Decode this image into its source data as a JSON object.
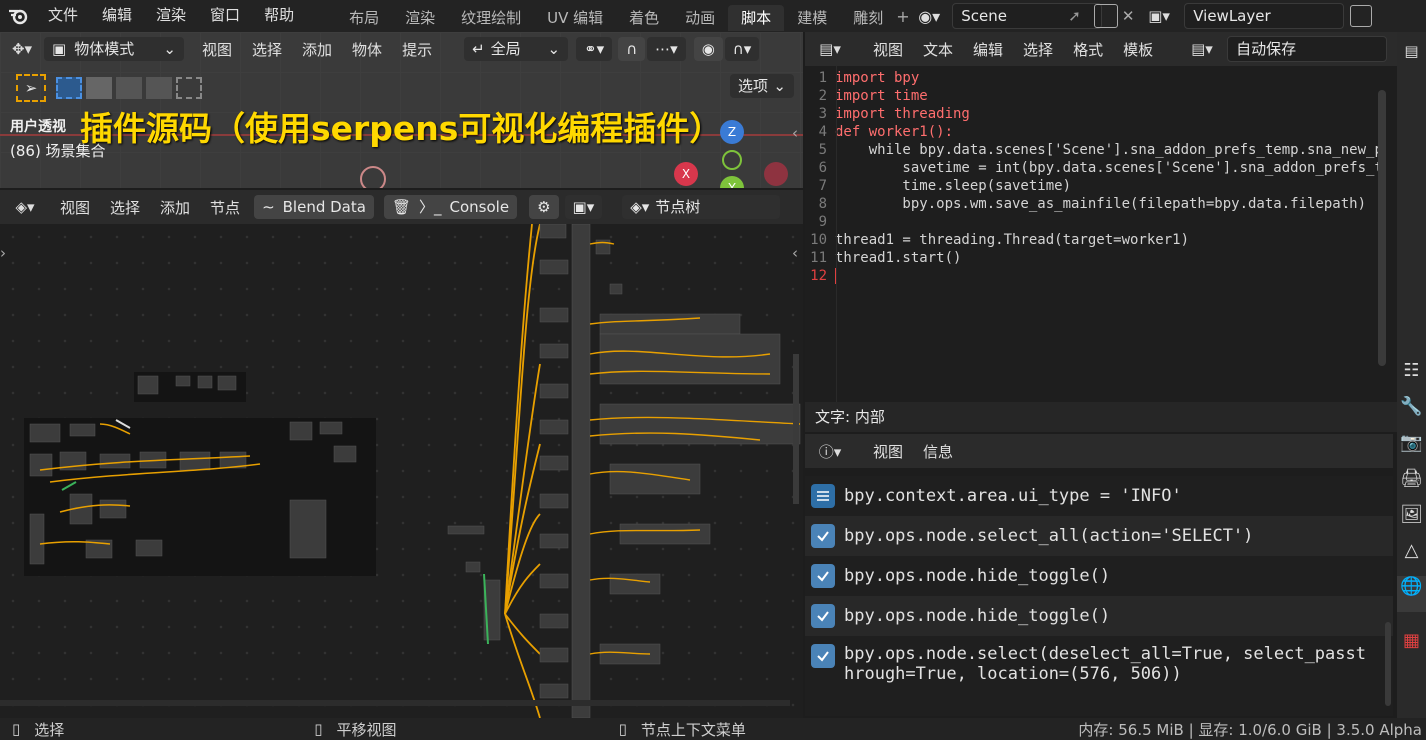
{
  "topbar": {
    "menus": [
      "文件",
      "编辑",
      "渲染",
      "窗口",
      "帮助"
    ],
    "workspaces": [
      "布局",
      "渲染",
      "纹理绘制",
      "UV 编辑",
      "着色",
      "动画",
      "脚本",
      "建模",
      "雕刻"
    ],
    "active_workspace": "脚本",
    "scene_name": "Scene",
    "view_layer": "ViewLayer"
  },
  "viewport": {
    "mode": "物体模式",
    "menus": [
      "视图",
      "选择",
      "添加",
      "物体",
      "提示"
    ],
    "transform_orientation": "全局",
    "options_label": "选项",
    "view_name": "用户透视",
    "collection": "(86) 场景集合",
    "overlay_title": "插件源码（使用serpens可视化编程插件）",
    "gizmo_axes": [
      "Z",
      "X",
      "Y"
    ]
  },
  "node_editor": {
    "menus": [
      "视图",
      "选择",
      "添加",
      "节点"
    ],
    "blend_data_label": "Blend Data",
    "console_label": "Console",
    "tree_name": "节点树"
  },
  "text_editor": {
    "menus": [
      "视图",
      "文本",
      "编辑",
      "选择",
      "格式",
      "模板"
    ],
    "file_name": "自动保存",
    "footer": "文字: 内部",
    "lines": [
      {
        "n": "1",
        "code": "import bpy"
      },
      {
        "n": "2",
        "code": "import time"
      },
      {
        "n": "3",
        "code": "import threading"
      },
      {
        "n": "4",
        "code": "def worker1():"
      },
      {
        "n": "5",
        "code": "    while bpy.data.scenes['Scene'].sna_addon_prefs_temp.sna_new_p"
      },
      {
        "n": "6",
        "code": "        savetime = int(bpy.data.scenes['Scene'].sna_addon_prefs_t"
      },
      {
        "n": "7",
        "code": "        time.sleep(savetime)"
      },
      {
        "n": "8",
        "code": "        bpy.ops.wm.save_as_mainfile(filepath=bpy.data.filepath)"
      },
      {
        "n": "9",
        "code": ""
      },
      {
        "n": "10",
        "code": "thread1 = threading.Thread(target=worker1)"
      },
      {
        "n": "11",
        "code": "thread1.start()"
      },
      {
        "n": "12",
        "code": ""
      }
    ]
  },
  "info_editor": {
    "menus": [
      "视图",
      "信息"
    ],
    "reports": [
      "bpy.context.area.ui_type = 'INFO'",
      "bpy.ops.node.select_all(action='SELECT')",
      "bpy.ops.node.hide_toggle()",
      "bpy.ops.node.hide_toggle()",
      "bpy.ops.node.select(deselect_all=True, select_passt",
      "hrough=True, location=(576, 506))"
    ]
  },
  "statusbar": {
    "left": "选择",
    "middle": "平移视图",
    "right_hint": "节点上下文菜单",
    "stats": "内存: 56.5 MiB | 显存: 1.0/6.0 GiB | 3.5.0 Alpha"
  }
}
